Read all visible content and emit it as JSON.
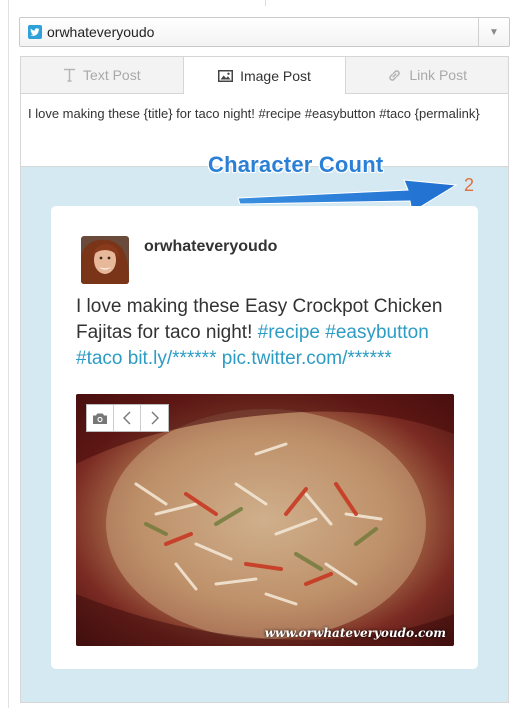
{
  "account": {
    "name": "orwhateveryoudo"
  },
  "tabs": [
    {
      "label": "Text Post",
      "icon": "text-icon",
      "active": false
    },
    {
      "label": "Image Post",
      "icon": "image-icon",
      "active": true
    },
    {
      "label": "Link Post",
      "icon": "link-icon",
      "active": false
    }
  ],
  "post": {
    "text": "I love making these {title} for taco night! #recipe #easybutton #taco {permalink}"
  },
  "annotation": {
    "label": "Character Count"
  },
  "char_count": "2",
  "preview": {
    "username": "orwhateveryoudo",
    "text_plain": "I love making these Easy Crockpot Chicken Fajitas for taco night! ",
    "text_tags": "#recipe #easybutton #taco bit.ly/****** pic.twitter.com/******",
    "watermark": "www.orwhateveryoudo.com"
  },
  "colors": {
    "panel_bg": "#d4e9f2",
    "link": "#2d9cc4",
    "annotation": "#2a7fd6",
    "count": "#e07040",
    "twitter_badge": "#2ea1d8"
  }
}
